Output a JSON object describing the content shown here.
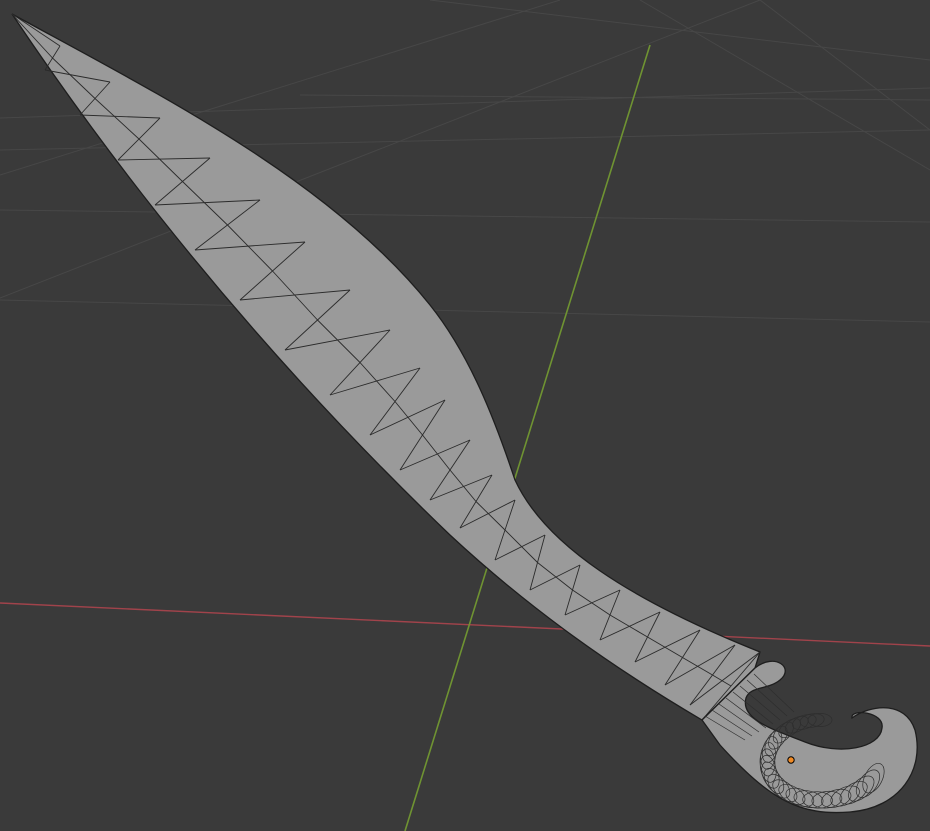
{
  "viewport": {
    "background": "#3a3a3a",
    "grid_color": "#474747",
    "x_axis_color": "#a1434b",
    "y_axis_color": "#6f9332",
    "mesh_fill": "#9a9a9a",
    "mesh_wire": "#222222",
    "origin_color": "#f08a24"
  }
}
